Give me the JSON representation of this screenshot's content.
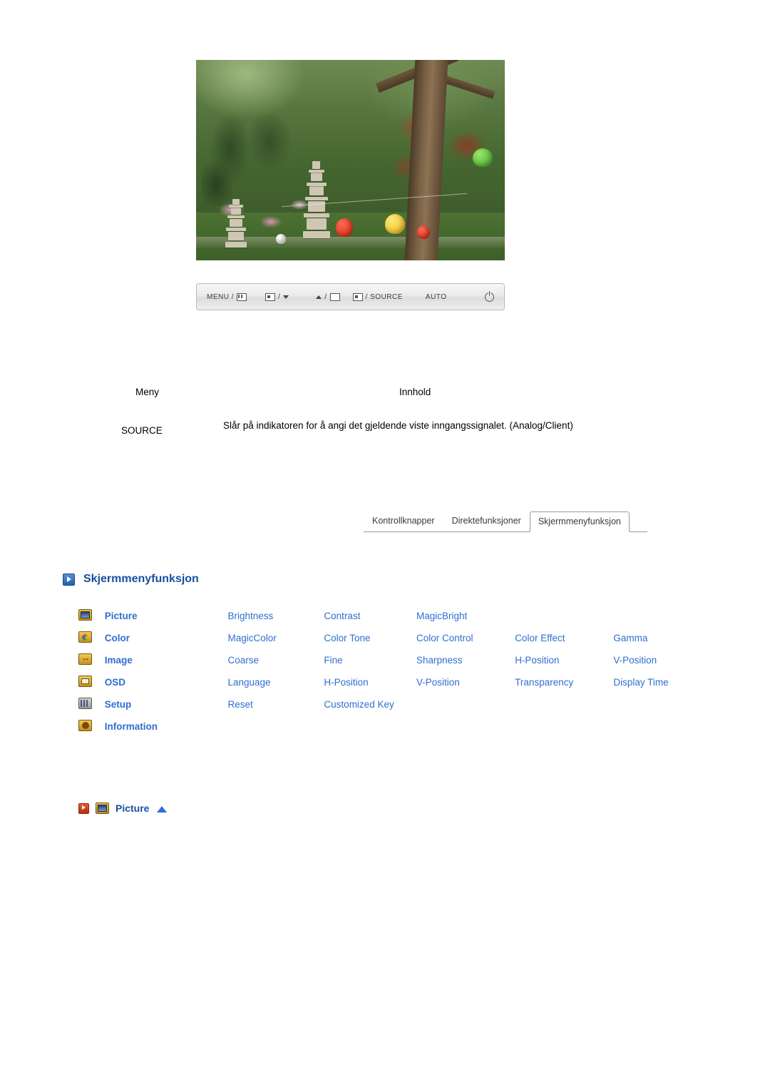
{
  "photo": {
    "alt_name": "monitor-sample-photo-pagoda-garden"
  },
  "control_bar": {
    "items": [
      {
        "name": "menu-button",
        "label": "MENU /",
        "glyph": "bars-box-icon"
      },
      {
        "name": "enter-down-button",
        "label": "/",
        "glyph_left": "enter-box-icon",
        "glyph_right": "triangle-down-icon"
      },
      {
        "name": "up-mute-button",
        "label": "/",
        "glyph_left": "triangle-up-icon",
        "glyph_right": "mute-icon"
      },
      {
        "name": "source-button",
        "label": "/ SOURCE",
        "glyph": "source-box-icon"
      },
      {
        "name": "auto-button",
        "label": "AUTO"
      },
      {
        "name": "power-button",
        "label": "",
        "glyph": "power-icon"
      }
    ]
  },
  "table": {
    "col_menu": "Meny",
    "col_content": "Innhold",
    "rows": [
      {
        "menu": "SOURCE",
        "content": "Slår på indikatoren for å angi det gjeldende viste inngangssignalet. (Analog/Client)"
      }
    ]
  },
  "tabs": [
    {
      "label": "Kontrollknapper",
      "active": false
    },
    {
      "label": "Direktefunksjoner",
      "active": false
    },
    {
      "label": "Skjermmenyfunksjon",
      "active": true
    }
  ],
  "section": {
    "title": "Skjermmenyfunksjon"
  },
  "osd": {
    "rows": [
      {
        "icon": "picture-icon",
        "category": "Picture",
        "items": [
          "Brightness",
          "Contrast",
          "MagicBright",
          "",
          ""
        ]
      },
      {
        "icon": "color-icon",
        "category": "Color",
        "items": [
          "MagicColor",
          "Color Tone",
          "Color Control",
          "Color Effect",
          "Gamma"
        ]
      },
      {
        "icon": "image-icon",
        "category": "Image",
        "items": [
          "Coarse",
          "Fine",
          "Sharpness",
          "H-Position",
          "V-Position"
        ]
      },
      {
        "icon": "osd-icon",
        "category": "OSD",
        "items": [
          "Language",
          "H-Position",
          "V-Position",
          "Transparency",
          "Display Time"
        ]
      },
      {
        "icon": "setup-icon",
        "category": "Setup",
        "items": [
          "Reset",
          "Customized Key",
          "",
          "",
          ""
        ]
      },
      {
        "icon": "information-icon",
        "category": "Information",
        "items": [
          "",
          "",
          "",
          "",
          ""
        ]
      }
    ]
  },
  "footer": {
    "label": "Picture"
  },
  "colors": {
    "link_blue": "#2f6fd0",
    "heading_blue": "#1a4fa0",
    "red_accent": "#b72d10"
  }
}
